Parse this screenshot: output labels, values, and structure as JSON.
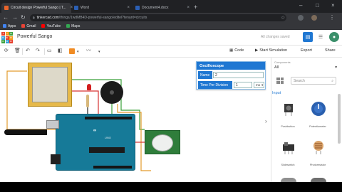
{
  "browser": {
    "tabs": [
      {
        "title": "Circuit design Powerful Sango | T...",
        "active": true
      },
      {
        "title": "Word",
        "active": false
      },
      {
        "title": "Document4.docx",
        "active": false
      }
    ],
    "url_host": "tinkercad.com",
    "url_path": "/things/1wdMB4D-powerful-sango/editel?tenant=circuits",
    "bookmarks": [
      "Apps",
      "Gmail",
      "YouTube",
      "Maps"
    ]
  },
  "header": {
    "design_title": "Powerful Sango",
    "save_status": "All changes saved"
  },
  "toolbar": {
    "code_label": "Code",
    "simulate_label": "Start Simulation",
    "export_label": "Export",
    "share_label": "Share"
  },
  "arduino": {
    "logo_text": "∞",
    "board_text": "UNO"
  },
  "inspector": {
    "title": "Oscilloscope",
    "name_label": "Name",
    "name_value": "2",
    "time_label": "Time Per Division",
    "time_value": "1",
    "time_unit": "ms"
  },
  "panel": {
    "components_label": "Components",
    "components_value": "All",
    "search_placeholder": "Search",
    "category": "Input",
    "items": [
      {
        "name": "Pushbutton"
      },
      {
        "name": "Potentiometer"
      },
      {
        "name": "Slideswitch"
      },
      {
        "name": "Photoresistor"
      }
    ]
  },
  "colors": {
    "accent": "#1f77d2",
    "arduino": "#167a98",
    "wire_orange": "#e39b2c",
    "wire_green": "#3aa13a",
    "wire_red": "#d63333"
  }
}
